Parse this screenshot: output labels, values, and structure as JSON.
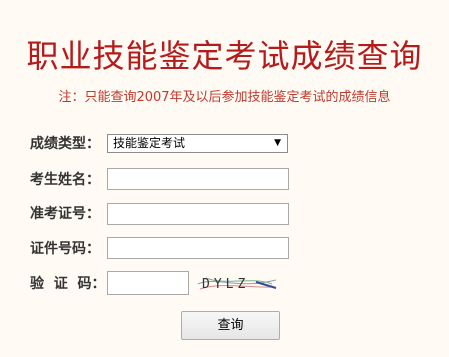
{
  "header": {
    "title": "职业技能鉴定考试成绩查询",
    "note": "注：只能查询2007年及以后参加技能鉴定考试的成绩信息"
  },
  "form": {
    "score_type": {
      "label": "成绩类型：",
      "selected": "技能鉴定考试"
    },
    "name": {
      "label": "考生姓名：",
      "value": ""
    },
    "admission_no": {
      "label": "准考证号：",
      "value": ""
    },
    "id_no": {
      "label": "证件号码：",
      "value": ""
    },
    "captcha": {
      "label": "验  证  码：",
      "value": "",
      "image_text": "DYLZ"
    },
    "submit_label": "查询"
  }
}
